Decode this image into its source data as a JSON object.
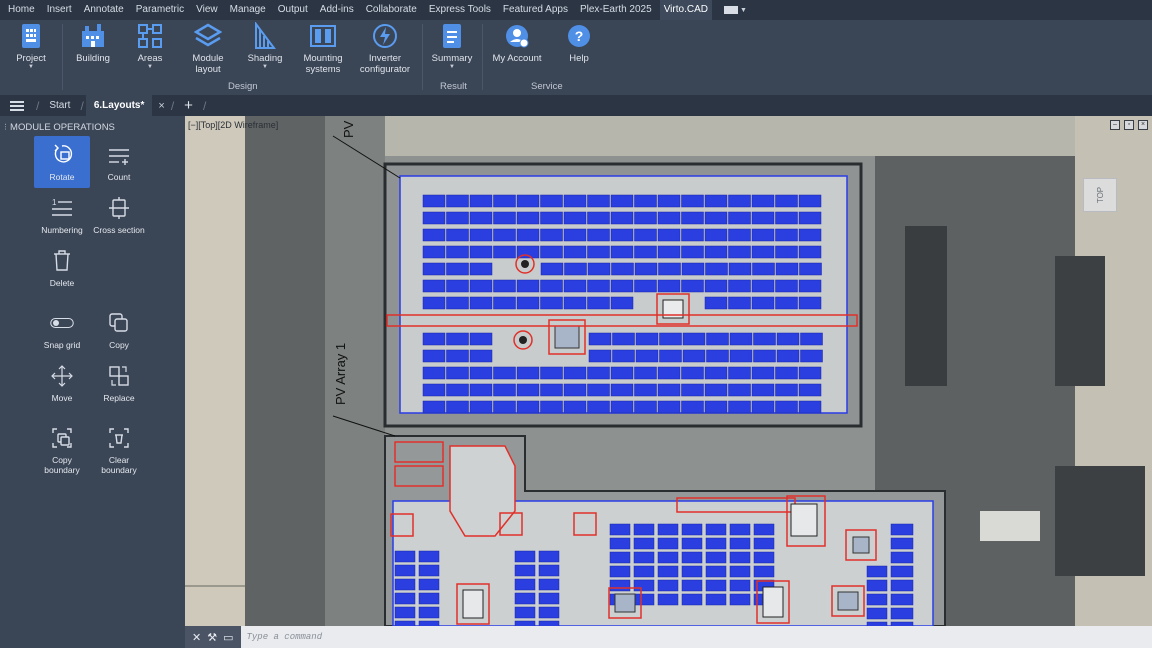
{
  "menu": {
    "items": [
      "Home",
      "Insert",
      "Annotate",
      "Parametric",
      "View",
      "Manage",
      "Output",
      "Add-ins",
      "Collaborate",
      "Express Tools",
      "Featured Apps",
      "Plex-Earth 2025",
      "Virto.CAD"
    ],
    "active_index": 12
  },
  "ribbon": {
    "buttons": {
      "project": "Project",
      "building": "Building",
      "areas": "Areas",
      "module_layout": "Module\nlayout",
      "shading": "Shading",
      "mounting_systems": "Mounting\nsystems",
      "inverter_configurator": "Inverter\nconfigurator",
      "summary": "Summary",
      "my_account": "My Account",
      "help": "Help"
    },
    "groups": {
      "design": "Design",
      "result": "Result",
      "service": "Service"
    }
  },
  "tabs": {
    "start": "Start",
    "active": "6.Layouts*",
    "close": "×",
    "add": "+"
  },
  "panel": {
    "title": "MODULE OPERATIONS",
    "tools": {
      "rotate": "Rotate",
      "count": "Count",
      "numbering": "Numbering",
      "cross_section": "Cross section",
      "delete": "Delete",
      "snap_grid": "Snap grid",
      "copy": "Copy",
      "move": "Move",
      "replace": "Replace",
      "copy_boundary": "Copy\nboundary",
      "clear_boundary": "Clear\nboundary"
    }
  },
  "viewport": {
    "label": "[−][Top][2D Wireframe]",
    "array_label": "PV Array 1",
    "array_label_top": "PV",
    "viewcube": "TOP"
  },
  "command": {
    "placeholder": "Type a command"
  },
  "colors": {
    "accent": "#3a6fd0",
    "module_fill": "#2b3fe0",
    "boundary_blue": "#2a3de6",
    "obstacle_red": "#e0302a",
    "ribbon_bg": "#3a4556",
    "menubar_bg": "#2b3544"
  }
}
